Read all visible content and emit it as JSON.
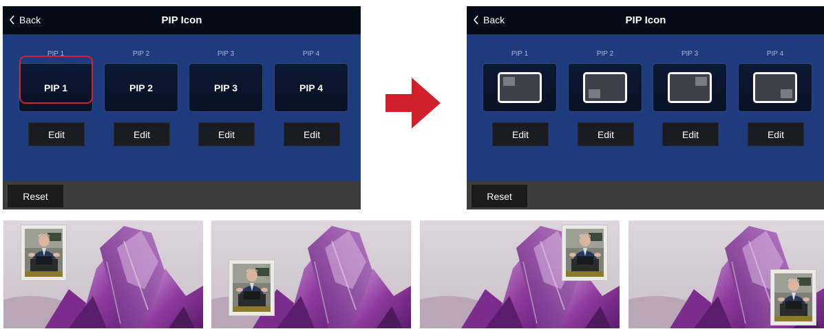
{
  "panels": {
    "before": {
      "back_label": "Back",
      "title": "PIP Icon",
      "columns": [
        {
          "label": "PIP 1",
          "button": "PIP 1",
          "edit": "Edit"
        },
        {
          "label": "PIP 2",
          "button": "PIP 2",
          "edit": "Edit"
        },
        {
          "label": "PIP 3",
          "button": "PIP 3",
          "edit": "Edit"
        },
        {
          "label": "PIP 4",
          "button": "PIP 4",
          "edit": "Edit"
        }
      ],
      "selected_column": "PIP 1",
      "reset_label": "Reset"
    },
    "after": {
      "back_label": "Back",
      "title": "PIP Icon",
      "columns": [
        {
          "label": "PIP 1",
          "icon": "pip-top-left-icon",
          "edit": "Edit"
        },
        {
          "label": "PIP 2",
          "icon": "pip-bottom-left-icon",
          "edit": "Edit"
        },
        {
          "label": "PIP 3",
          "icon": "pip-top-right-icon",
          "edit": "Edit"
        },
        {
          "label": "PIP 4",
          "icon": "pip-bottom-right-icon",
          "edit": "Edit"
        }
      ],
      "reset_label": "Reset"
    }
  },
  "arrow_icon": "right-arrow-icon",
  "previews": [
    {
      "pip_position": "top-left"
    },
    {
      "pip_position": "bottom-left"
    },
    {
      "pip_position": "top-right"
    },
    {
      "pip_position": "bottom-right"
    }
  ],
  "colors": {
    "panel_bg": "#1e3b7e",
    "title_bar": "#050b17",
    "selection_outline": "#d3232b",
    "arrow": "#d0202a",
    "crystal": "#8e3a9e"
  }
}
